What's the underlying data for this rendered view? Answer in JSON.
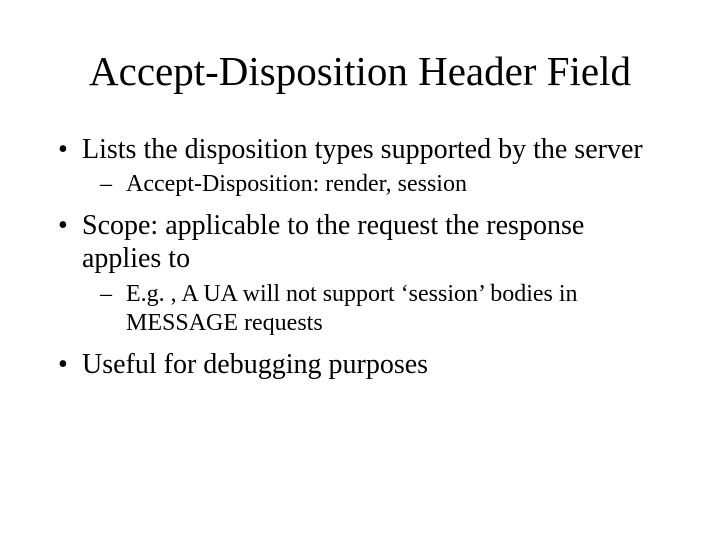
{
  "title": "Accept-Disposition Header Field",
  "bullets": [
    {
      "text": "Lists the disposition types supported by the server",
      "sub": [
        "Accept-Disposition: render, session"
      ]
    },
    {
      "text": "Scope: applicable to the request the response applies to",
      "sub": [
        "E.g. , A UA will not support ‘session’ bodies in MESSAGE requests"
      ]
    },
    {
      "text": "Useful for debugging purposes",
      "sub": []
    }
  ]
}
